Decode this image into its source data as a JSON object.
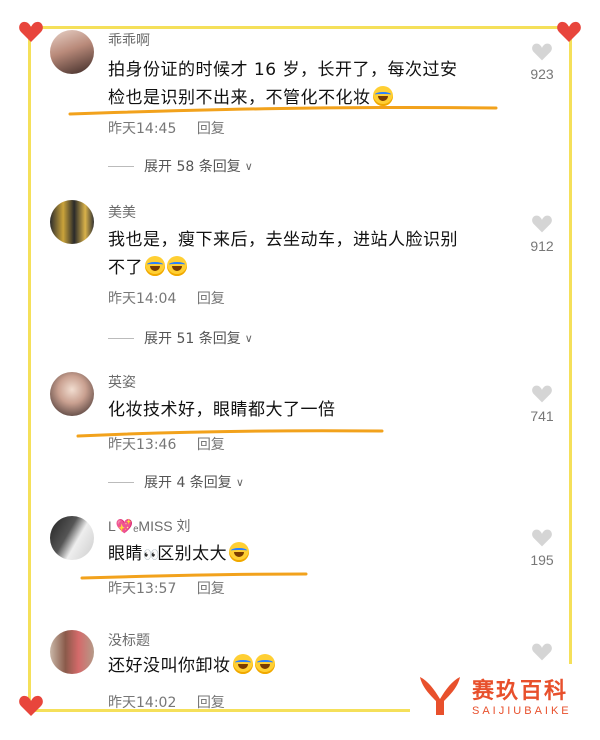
{
  "comments": [
    {
      "username": "乖乖啊",
      "text_line1": "拍身份证的时候才 16 岁，长开了，每次过安",
      "text_line2": "检也是识别不出来，不管化不化妆",
      "time": "昨天14:45",
      "reply_label": "回复",
      "likes": "923",
      "expand_label": "展开 58 条回复"
    },
    {
      "username": "美美",
      "text_line1": "我也是，瘦下来后，去坐动车，进站人脸识别",
      "text_line2": "不了",
      "time": "昨天14:04",
      "reply_label": "回复",
      "likes": "912",
      "expand_label": "展开 51 条回复"
    },
    {
      "username": "英姿",
      "text_line1": "化妆技术好，眼睛都大了一倍",
      "time": "昨天13:46",
      "reply_label": "回复",
      "likes": "741",
      "expand_label": "展开 4 条回复"
    },
    {
      "username": "L💖ₑMISS 刘",
      "text_before": "眼睛",
      "text_after": "区别太大",
      "eyes": "👀",
      "time": "昨天13:57",
      "reply_label": "回复",
      "likes": "195"
    },
    {
      "username": "没标题",
      "text_line1": "还好没叫你卸妆",
      "time": "昨天14:02",
      "reply_label": "回复"
    }
  ],
  "brand": {
    "name_cn": "赛玖百科",
    "name_en": "SAIJIUBAIKE"
  },
  "colors": {
    "frame": "#f5e05a",
    "heart": "#e8453c",
    "underline": "#f2a21c",
    "brand": "#e8502c"
  },
  "icons": [
    "heart-icon",
    "like-icon",
    "chevron-down-icon",
    "laugh-cry-emoji",
    "eyes-emoji"
  ]
}
